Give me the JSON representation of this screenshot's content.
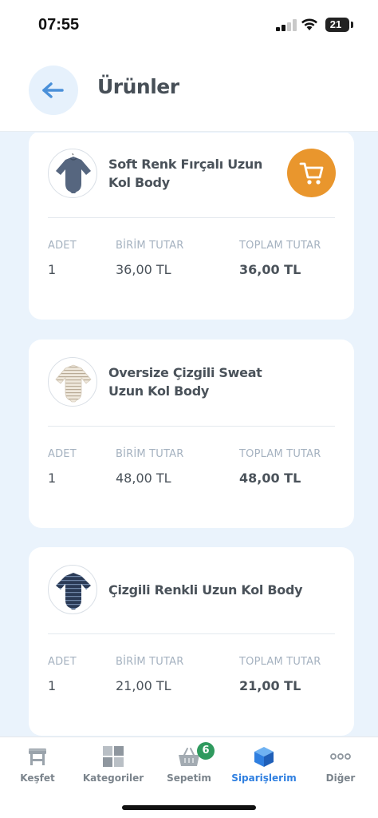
{
  "status_bar": {
    "time": "07:55",
    "battery": "21"
  },
  "header": {
    "title": "Ürünler",
    "back_icon": "arrow-left-icon"
  },
  "colors": {
    "accent": "#2f7fe0",
    "cart_button": "#e9962d",
    "badge": "#2f9a5e",
    "background": "#eaf3fc"
  },
  "products": [
    {
      "name": "Soft Renk Fırçalı Uzun Kol Body",
      "adet_label": "ADET",
      "adet": "1",
      "birim_label": "BİRİM TUTAR",
      "birim": "36,00 TL",
      "toplam_label": "TOPLAM TUTAR",
      "toplam": "36,00 TL",
      "image": "navy-bodysuit"
    },
    {
      "name": "Oversize Çizgili Sweat Uzun Kol Body",
      "adet_label": "ADET",
      "adet": "1",
      "birim_label": "BİRİM TUTAR",
      "birim": "48,00 TL",
      "toplam_label": "TOPLAM TUTAR",
      "toplam": "48,00 TL",
      "image": "striped-cream-bodysuit"
    },
    {
      "name": "Çizgili Renkli Uzun Kol Body",
      "adet_label": "ADET",
      "adet": "1",
      "birim_label": "BİRİM TUTAR",
      "birim": "21,00 TL",
      "toplam_label": "TOPLAM TUTAR",
      "toplam": "21,00 TL",
      "image": "striped-navy-bodysuit"
    }
  ],
  "tabbar": {
    "tabs": [
      {
        "label": "Keşfet",
        "icon": "storefront-icon"
      },
      {
        "label": "Kategoriler",
        "icon": "grid-icon"
      },
      {
        "label": "Sepetim",
        "icon": "basket-icon",
        "badge": "6"
      },
      {
        "label": "Siparişlerim",
        "icon": "box-icon",
        "active": true
      },
      {
        "label": "Diğer",
        "icon": "more-dots-icon"
      }
    ]
  }
}
